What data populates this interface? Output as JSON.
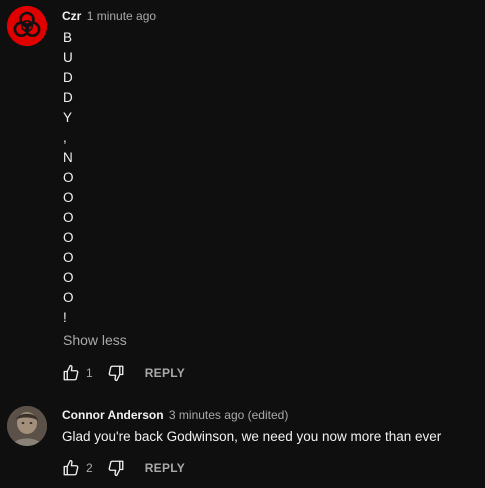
{
  "comments": [
    {
      "author": "Czr",
      "meta": "1 minute ago",
      "lines": [
        "B",
        "U",
        "D",
        "D",
        "Y",
        ",",
        "N",
        "O",
        "O",
        "O",
        "O",
        "O",
        "O",
        "O",
        "!"
      ],
      "show_less": "Show less",
      "likes": "1",
      "reply": "REPLY",
      "avatar_color": "#e00000"
    },
    {
      "author": "Connor Anderson",
      "meta": "3 minutes ago (edited)",
      "text": "Glad you're back Godwinson, we need you now more than ever",
      "likes": "2",
      "reply": "REPLY"
    }
  ],
  "icons": {
    "avatar_1": "biohazard-icon",
    "like": "thumbs-up-icon",
    "dislike": "thumbs-down-icon"
  },
  "colors": {
    "background": "#0f0f0f",
    "primary_text": "#f1f1f1",
    "secondary_text": "#aaaaaa"
  }
}
